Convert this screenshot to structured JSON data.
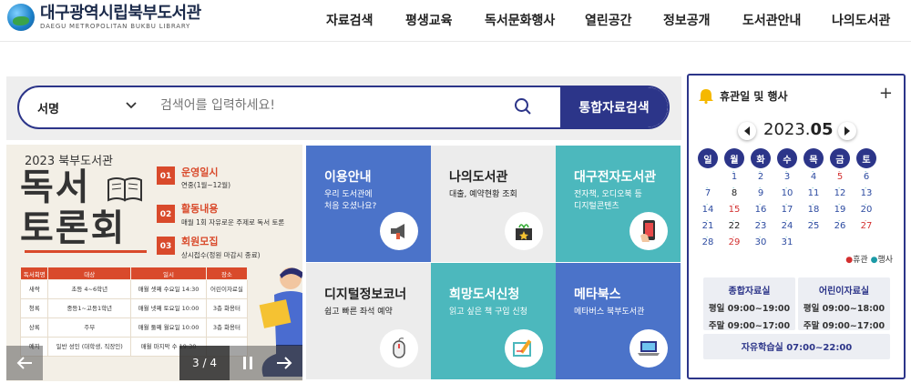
{
  "header": {
    "logo_main": "대구광역시립북부도서관",
    "logo_sub": "DAEGU METROPOLITAN BUKBU LIBRARY",
    "nav": [
      "자료검색",
      "평생교육",
      "독서문화행사",
      "열린공간",
      "정보공개",
      "도서관안내",
      "나의도서관"
    ]
  },
  "search": {
    "select_value": "서명",
    "placeholder": "검색어를 입력하세요!",
    "button_label": "통합자료검색"
  },
  "banner": {
    "year": "2023 북부도서관",
    "title_line1": "독서",
    "title_line2": "토론회",
    "parts": [
      {
        "num": "PART 01",
        "title": "운영일시",
        "desc": "연중(1월~12월)"
      },
      {
        "num": "PART 02",
        "title": "활동내용",
        "desc": "매월 1회 자유로운 주제로 독서 토론"
      },
      {
        "num": "PART 03",
        "title": "회원모집",
        "desc": "상시접수(정원 마감시 종료)"
      }
    ],
    "table_headers": [
      "독서회명",
      "대상",
      "일시",
      "장소"
    ],
    "table_rows": [
      [
        "새싹",
        "초등 4~6학년",
        "매월 셋째 수요일 14:30",
        "어린이자료실"
      ],
      [
        "청록",
        "중등1~고등1학년",
        "매월 넷째 토요일 10:00",
        "3층 화용터"
      ],
      [
        "상록",
        "주부",
        "매월 둘째 월요일 10:00",
        "3층 화용터"
      ],
      [
        "예지",
        "일반 성인 (대학생, 직장인)",
        "매월 마지막 수 19:30",
        ""
      ]
    ],
    "counter": "3 / 4"
  },
  "tiles": [
    {
      "title": "이용안내",
      "desc": "우리 도서관에\n처음 오셨나요?",
      "icon": "megaphone-icon"
    },
    {
      "title": "나의도서관",
      "desc": "대출, 예약현황 조회",
      "icon": "gift-star-icon"
    },
    {
      "title": "대구전자도서관",
      "desc": "전자책, 오디오북 등\n디지털콘텐츠",
      "icon": "phone-touch-icon"
    },
    {
      "title": "디지털정보코너",
      "desc": "쉽고 빠른 좌석 예약",
      "icon": "mouse-icon"
    },
    {
      "title": "희망도서신청",
      "desc": "읽고 싶은 책 구입 신청",
      "icon": "pencil-board-icon"
    },
    {
      "title": "메타북스",
      "desc": "메타버스 북부도서관",
      "icon": "laptop-icon"
    }
  ],
  "calendar": {
    "header_title": "휴관일 및 행사",
    "year": "2023.",
    "month": "05",
    "weekdays": [
      "일",
      "월",
      "화",
      "수",
      "목",
      "금",
      "토"
    ],
    "weeks": [
      [
        "",
        "1",
        "2",
        "3",
        "4",
        "5",
        "6"
      ],
      [
        "7",
        "8",
        "9",
        "10",
        "11",
        "12",
        "13"
      ],
      [
        "14",
        "15",
        "16",
        "17",
        "18",
        "19",
        "20"
      ],
      [
        "21",
        "22",
        "23",
        "24",
        "25",
        "26",
        "27"
      ],
      [
        "28",
        "29",
        "30",
        "31",
        "",
        "",
        ""
      ]
    ],
    "legend_closed": "휴관",
    "legend_event": "행사",
    "hours": [
      {
        "title": "종합자료실",
        "lines": [
          "평일 09:00~19:00",
          "주말 09:00~17:00"
        ]
      },
      {
        "title": "어린이자료실",
        "lines": [
          "평일 09:00~18:00",
          "주말 09:00~17:00"
        ]
      }
    ],
    "study_room": "자유학습실 07:00~22:00",
    "colors": {
      "accent": "#2c3589",
      "holiday": "#d32f2f",
      "event": "#1b9aa6"
    }
  }
}
